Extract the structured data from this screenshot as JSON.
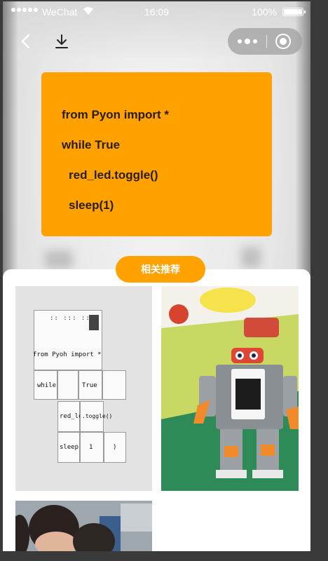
{
  "status_bar": {
    "carrier": "WeChat",
    "time": "16:09",
    "battery": "100%"
  },
  "code_card": {
    "lines": [
      "from Pyon import *",
      "while True",
      "red_led.toggle()",
      "sleep(1)"
    ],
    "background": "#ffa200"
  },
  "recommend_button": {
    "label": "相关推荐"
  },
  "photos": {
    "tile1": {
      "header": "from Pyoh import *",
      "blocks": [
        "while",
        "True",
        "red_led",
        ".toggle()",
        "sleep(",
        "1",
        ")"
      ]
    }
  },
  "icons": [
    "back-icon",
    "download-icon",
    "more-icon",
    "close-icon",
    "wifi-icon",
    "battery-icon"
  ]
}
